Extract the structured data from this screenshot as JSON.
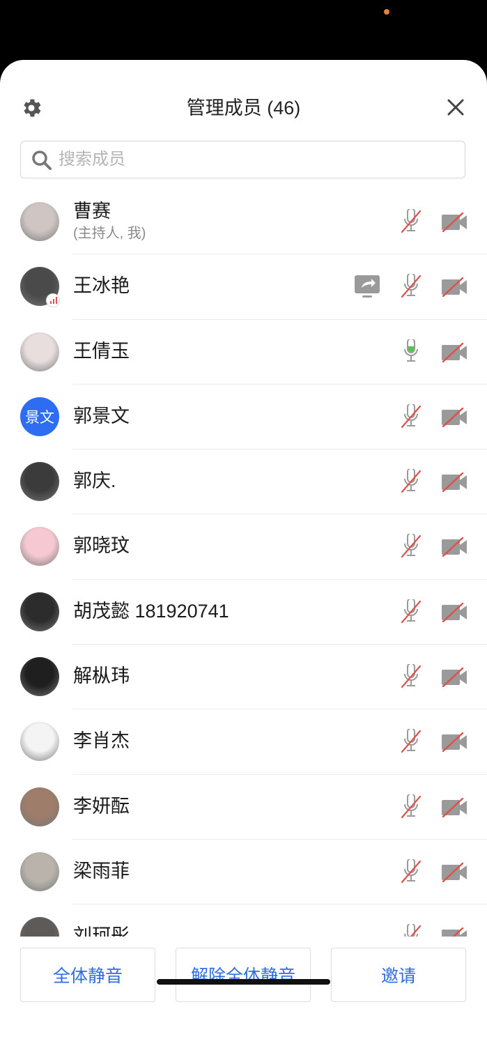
{
  "header": {
    "title": "管理成员 (46)"
  },
  "search": {
    "placeholder": "搜索成员"
  },
  "members": [
    {
      "name": "曹赛",
      "sub": "(主持人, 我)",
      "mic": "muted",
      "camera": "off",
      "avatar": "photo"
    },
    {
      "name": "王冰艳",
      "mic": "muted",
      "camera": "off",
      "sharing": true,
      "avatar": "photo"
    },
    {
      "name": "王倩玉",
      "mic": "active",
      "camera": "off",
      "avatar": "photo"
    },
    {
      "name": "郭景文",
      "mic": "muted",
      "camera": "off",
      "avatar_text": "景文"
    },
    {
      "name": "郭庆.",
      "mic": "muted",
      "camera": "off",
      "avatar": "photo"
    },
    {
      "name": "郭晓玟",
      "mic": "muted",
      "camera": "off",
      "avatar": "photo"
    },
    {
      "name": "胡茂懿 181920741",
      "mic": "muted",
      "camera": "off",
      "avatar": "photo"
    },
    {
      "name": "解枞玮",
      "mic": "muted",
      "camera": "off",
      "avatar": "photo"
    },
    {
      "name": "李肖杰",
      "mic": "muted",
      "camera": "off",
      "avatar": "photo"
    },
    {
      "name": "李妍酝",
      "mic": "muted",
      "camera": "off",
      "avatar": "photo"
    },
    {
      "name": "梁雨菲",
      "mic": "muted",
      "camera": "off",
      "avatar": "photo"
    },
    {
      "name": "刘珂彤",
      "mic": "muted",
      "camera": "off",
      "avatar": "photo"
    }
  ],
  "footer": {
    "mute_all": "全体静音",
    "unmute_all": "解除全体静音",
    "invite": "邀请"
  },
  "colors": {
    "accent": "#2f6de0",
    "avatar_text_bg": "#2e6cf1",
    "muted_slash": "#e0504a",
    "mic_active": "#4cc84a",
    "icon_gray": "#9a9a9a"
  }
}
